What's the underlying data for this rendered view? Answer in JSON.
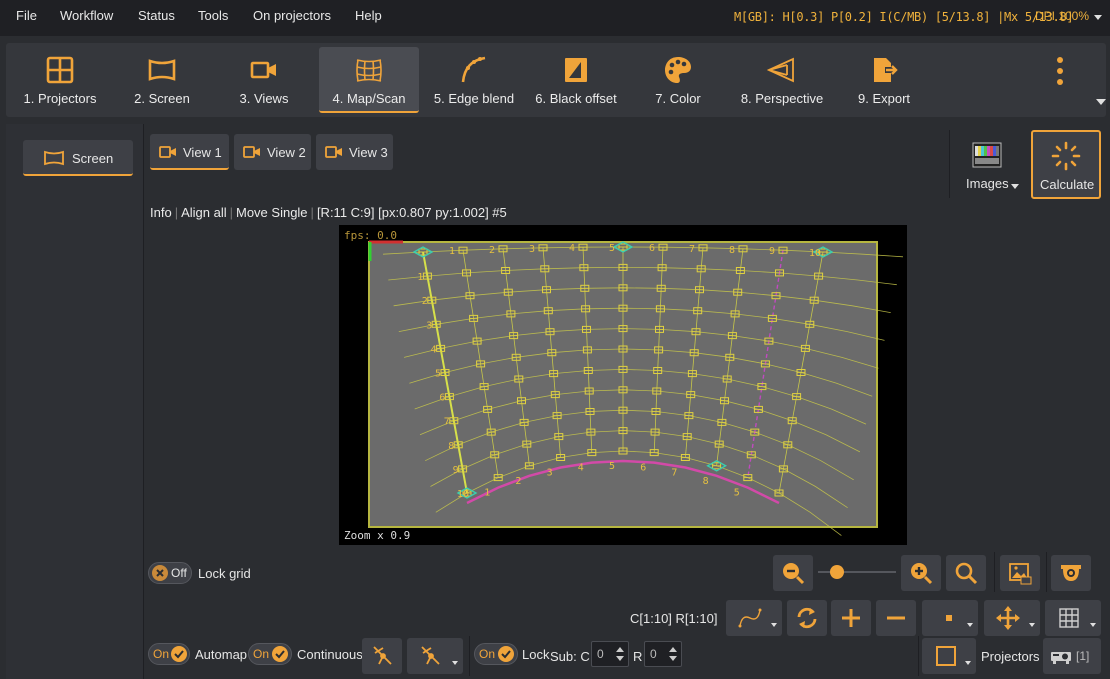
{
  "menu": [
    "File",
    "Workflow",
    "Status",
    "Tools",
    "On projectors",
    "Help"
  ],
  "status": "M[GB]: H[0.3] P[0.2] I(C/MB) [5/13.8] |Mx 5/13.8]",
  "dpi": "DPI 100%",
  "toolbar": {
    "items": [
      {
        "label": "1. Projectors",
        "icon": "projectors-grid-icon"
      },
      {
        "label": "2. Screen",
        "icon": "screen-icon"
      },
      {
        "label": "3. Views",
        "icon": "camera-icon"
      },
      {
        "label": "4. Map/Scan",
        "icon": "mesh-warp-icon"
      },
      {
        "label": "5. Edge blend",
        "icon": "edge-blend-curve-icon"
      },
      {
        "label": "6. Black offset",
        "icon": "black-offset-icon"
      },
      {
        "label": "7. Color",
        "icon": "palette-icon"
      },
      {
        "label": "8. Perspective",
        "icon": "perspective-icon"
      },
      {
        "label": "9. Export",
        "icon": "export-icon"
      }
    ],
    "active": "4. Map/Scan",
    "accent": "#f0a43a"
  },
  "left": {
    "screen_label": "Screen"
  },
  "views": [
    "View 1",
    "View 2",
    "View 3"
  ],
  "images_label": "Images",
  "calculate_label": "Calculate",
  "infobar": {
    "info": "Info",
    "align_all": "Align all",
    "move_single": "Move Single",
    "readout": "[R:11 C:9] [px:0.807 py:1.002] #5"
  },
  "viewport": {
    "fps": "fps: 0.0",
    "zoom": "Zoom x 0.9",
    "top_labels": [
      "1",
      "2",
      "3",
      "4",
      "5",
      "6",
      "7",
      "8",
      "9",
      "10"
    ],
    "left_labels": [
      "1",
      "2",
      "3",
      "4",
      "5",
      "6",
      "7",
      "8",
      "9",
      "10"
    ],
    "bottom_labels": [
      "1",
      "2",
      "3",
      "4",
      "5",
      "6",
      "7",
      "8",
      "5"
    ]
  },
  "lock_grid": {
    "state": "Off",
    "label": "Lock grid"
  },
  "range_label": "C[1:10] R[1:10]",
  "bottom": {
    "automap": {
      "state": "On",
      "label": "Automap"
    },
    "continuous": {
      "state": "On",
      "label": "Continuous"
    },
    "lock": {
      "state": "On",
      "label": "Lock"
    },
    "sub_label": "Sub: C",
    "sub_c": "0",
    "r_label": "R",
    "sub_r": "0",
    "projectors_label": "Projectors",
    "projectors_count": "[1]"
  }
}
